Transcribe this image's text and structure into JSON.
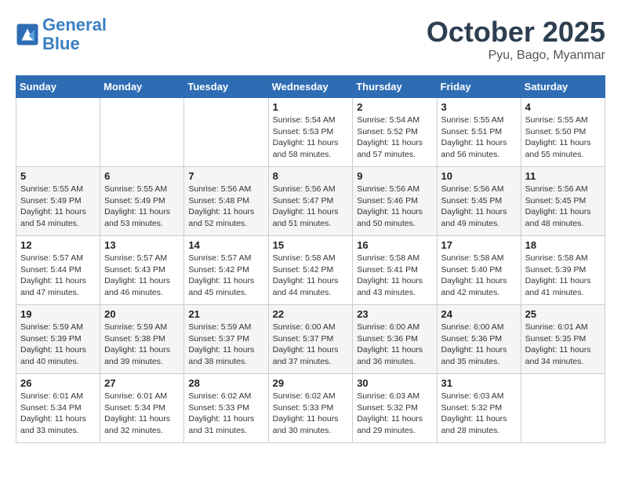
{
  "header": {
    "logo_line1": "General",
    "logo_line2": "Blue",
    "month": "October 2025",
    "location": "Pyu, Bago, Myanmar"
  },
  "weekdays": [
    "Sunday",
    "Monday",
    "Tuesday",
    "Wednesday",
    "Thursday",
    "Friday",
    "Saturday"
  ],
  "weeks": [
    [
      {
        "day": "",
        "info": ""
      },
      {
        "day": "",
        "info": ""
      },
      {
        "day": "",
        "info": ""
      },
      {
        "day": "1",
        "info": "Sunrise: 5:54 AM\nSunset: 5:53 PM\nDaylight: 11 hours\nand 58 minutes."
      },
      {
        "day": "2",
        "info": "Sunrise: 5:54 AM\nSunset: 5:52 PM\nDaylight: 11 hours\nand 57 minutes."
      },
      {
        "day": "3",
        "info": "Sunrise: 5:55 AM\nSunset: 5:51 PM\nDaylight: 11 hours\nand 56 minutes."
      },
      {
        "day": "4",
        "info": "Sunrise: 5:55 AM\nSunset: 5:50 PM\nDaylight: 11 hours\nand 55 minutes."
      }
    ],
    [
      {
        "day": "5",
        "info": "Sunrise: 5:55 AM\nSunset: 5:49 PM\nDaylight: 11 hours\nand 54 minutes."
      },
      {
        "day": "6",
        "info": "Sunrise: 5:55 AM\nSunset: 5:49 PM\nDaylight: 11 hours\nand 53 minutes."
      },
      {
        "day": "7",
        "info": "Sunrise: 5:56 AM\nSunset: 5:48 PM\nDaylight: 11 hours\nand 52 minutes."
      },
      {
        "day": "8",
        "info": "Sunrise: 5:56 AM\nSunset: 5:47 PM\nDaylight: 11 hours\nand 51 minutes."
      },
      {
        "day": "9",
        "info": "Sunrise: 5:56 AM\nSunset: 5:46 PM\nDaylight: 11 hours\nand 50 minutes."
      },
      {
        "day": "10",
        "info": "Sunrise: 5:56 AM\nSunset: 5:45 PM\nDaylight: 11 hours\nand 49 minutes."
      },
      {
        "day": "11",
        "info": "Sunrise: 5:56 AM\nSunset: 5:45 PM\nDaylight: 11 hours\nand 48 minutes."
      }
    ],
    [
      {
        "day": "12",
        "info": "Sunrise: 5:57 AM\nSunset: 5:44 PM\nDaylight: 11 hours\nand 47 minutes."
      },
      {
        "day": "13",
        "info": "Sunrise: 5:57 AM\nSunset: 5:43 PM\nDaylight: 11 hours\nand 46 minutes."
      },
      {
        "day": "14",
        "info": "Sunrise: 5:57 AM\nSunset: 5:42 PM\nDaylight: 11 hours\nand 45 minutes."
      },
      {
        "day": "15",
        "info": "Sunrise: 5:58 AM\nSunset: 5:42 PM\nDaylight: 11 hours\nand 44 minutes."
      },
      {
        "day": "16",
        "info": "Sunrise: 5:58 AM\nSunset: 5:41 PM\nDaylight: 11 hours\nand 43 minutes."
      },
      {
        "day": "17",
        "info": "Sunrise: 5:58 AM\nSunset: 5:40 PM\nDaylight: 11 hours\nand 42 minutes."
      },
      {
        "day": "18",
        "info": "Sunrise: 5:58 AM\nSunset: 5:39 PM\nDaylight: 11 hours\nand 41 minutes."
      }
    ],
    [
      {
        "day": "19",
        "info": "Sunrise: 5:59 AM\nSunset: 5:39 PM\nDaylight: 11 hours\nand 40 minutes."
      },
      {
        "day": "20",
        "info": "Sunrise: 5:59 AM\nSunset: 5:38 PM\nDaylight: 11 hours\nand 39 minutes."
      },
      {
        "day": "21",
        "info": "Sunrise: 5:59 AM\nSunset: 5:37 PM\nDaylight: 11 hours\nand 38 minutes."
      },
      {
        "day": "22",
        "info": "Sunrise: 6:00 AM\nSunset: 5:37 PM\nDaylight: 11 hours\nand 37 minutes."
      },
      {
        "day": "23",
        "info": "Sunrise: 6:00 AM\nSunset: 5:36 PM\nDaylight: 11 hours\nand 36 minutes."
      },
      {
        "day": "24",
        "info": "Sunrise: 6:00 AM\nSunset: 5:36 PM\nDaylight: 11 hours\nand 35 minutes."
      },
      {
        "day": "25",
        "info": "Sunrise: 6:01 AM\nSunset: 5:35 PM\nDaylight: 11 hours\nand 34 minutes."
      }
    ],
    [
      {
        "day": "26",
        "info": "Sunrise: 6:01 AM\nSunset: 5:34 PM\nDaylight: 11 hours\nand 33 minutes."
      },
      {
        "day": "27",
        "info": "Sunrise: 6:01 AM\nSunset: 5:34 PM\nDaylight: 11 hours\nand 32 minutes."
      },
      {
        "day": "28",
        "info": "Sunrise: 6:02 AM\nSunset: 5:33 PM\nDaylight: 11 hours\nand 31 minutes."
      },
      {
        "day": "29",
        "info": "Sunrise: 6:02 AM\nSunset: 5:33 PM\nDaylight: 11 hours\nand 30 minutes."
      },
      {
        "day": "30",
        "info": "Sunrise: 6:03 AM\nSunset: 5:32 PM\nDaylight: 11 hours\nand 29 minutes."
      },
      {
        "day": "31",
        "info": "Sunrise: 6:03 AM\nSunset: 5:32 PM\nDaylight: 11 hours\nand 28 minutes."
      },
      {
        "day": "",
        "info": ""
      }
    ]
  ]
}
